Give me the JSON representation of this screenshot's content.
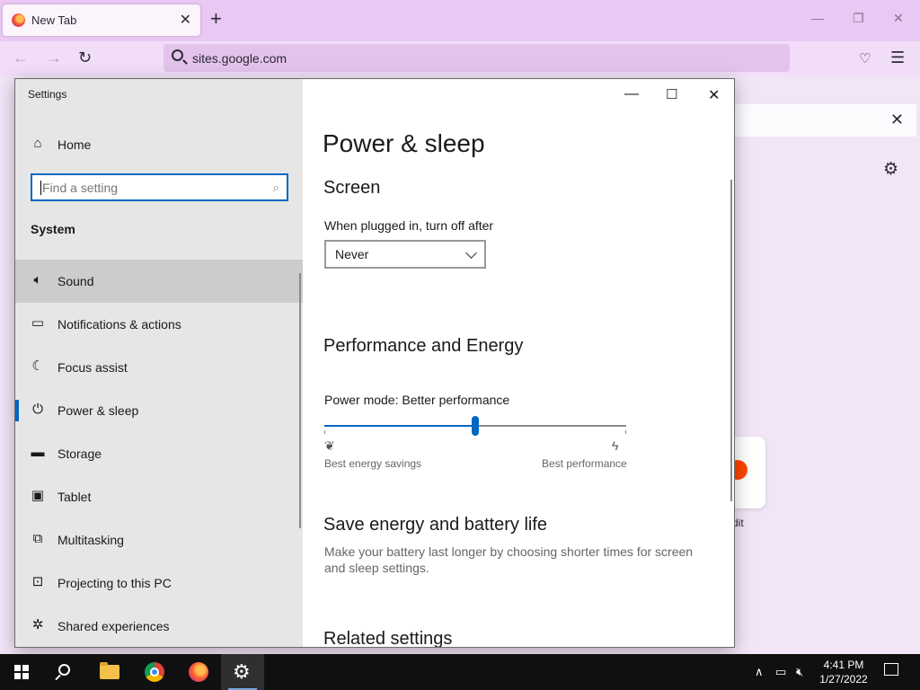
{
  "browser": {
    "tab_title": "New Tab",
    "tab_close": "✕",
    "new_tab": "+",
    "url": "sites.google.com",
    "bar_close": "✕",
    "tile_label": "dit"
  },
  "settings": {
    "app_title": "Settings",
    "home_label": "Home",
    "search_placeholder": "Find a setting",
    "section_heading": "System",
    "nav_items": [
      {
        "label": "Sound",
        "icon": "speaker-icon"
      },
      {
        "label": "Notifications & actions",
        "icon": "notification-icon"
      },
      {
        "label": "Focus assist",
        "icon": "moon-icon"
      },
      {
        "label": "Power & sleep",
        "icon": "power-icon"
      },
      {
        "label": "Storage",
        "icon": "storage-icon"
      },
      {
        "label": "Tablet",
        "icon": "tablet-icon"
      },
      {
        "label": "Multitasking",
        "icon": "multitasking-icon"
      },
      {
        "label": "Projecting to this PC",
        "icon": "projecting-icon"
      },
      {
        "label": "Shared experiences",
        "icon": "shared-experiences-icon"
      }
    ],
    "selected_item": "Power & sleep",
    "page_title": "Power & sleep",
    "screen_heading": "Screen",
    "plugged_label": "When plugged in, turn off after",
    "plugged_value": "Never",
    "perf_heading": "Performance and Energy",
    "power_mode_label": "Power mode: Better performance",
    "power_mode_level": 0.5,
    "slider_min_caption": "Best energy savings",
    "slider_max_caption": "Best performance",
    "save_heading": "Save energy and battery life",
    "save_desc": "Make your battery last longer by choosing shorter times for screen and sleep settings.",
    "related_heading": "Related settings"
  },
  "taskbar": {
    "time": "4:41 PM",
    "date": "1/27/2022",
    "apps": [
      "start",
      "search",
      "file-explorer",
      "chrome",
      "firefox",
      "settings"
    ],
    "active_app": "settings"
  },
  "colors": {
    "accent": "#0067c0",
    "browser_tabbar": "#e9c8f3",
    "sidebar": "#e6e6e6",
    "taskbar": "#101010"
  }
}
